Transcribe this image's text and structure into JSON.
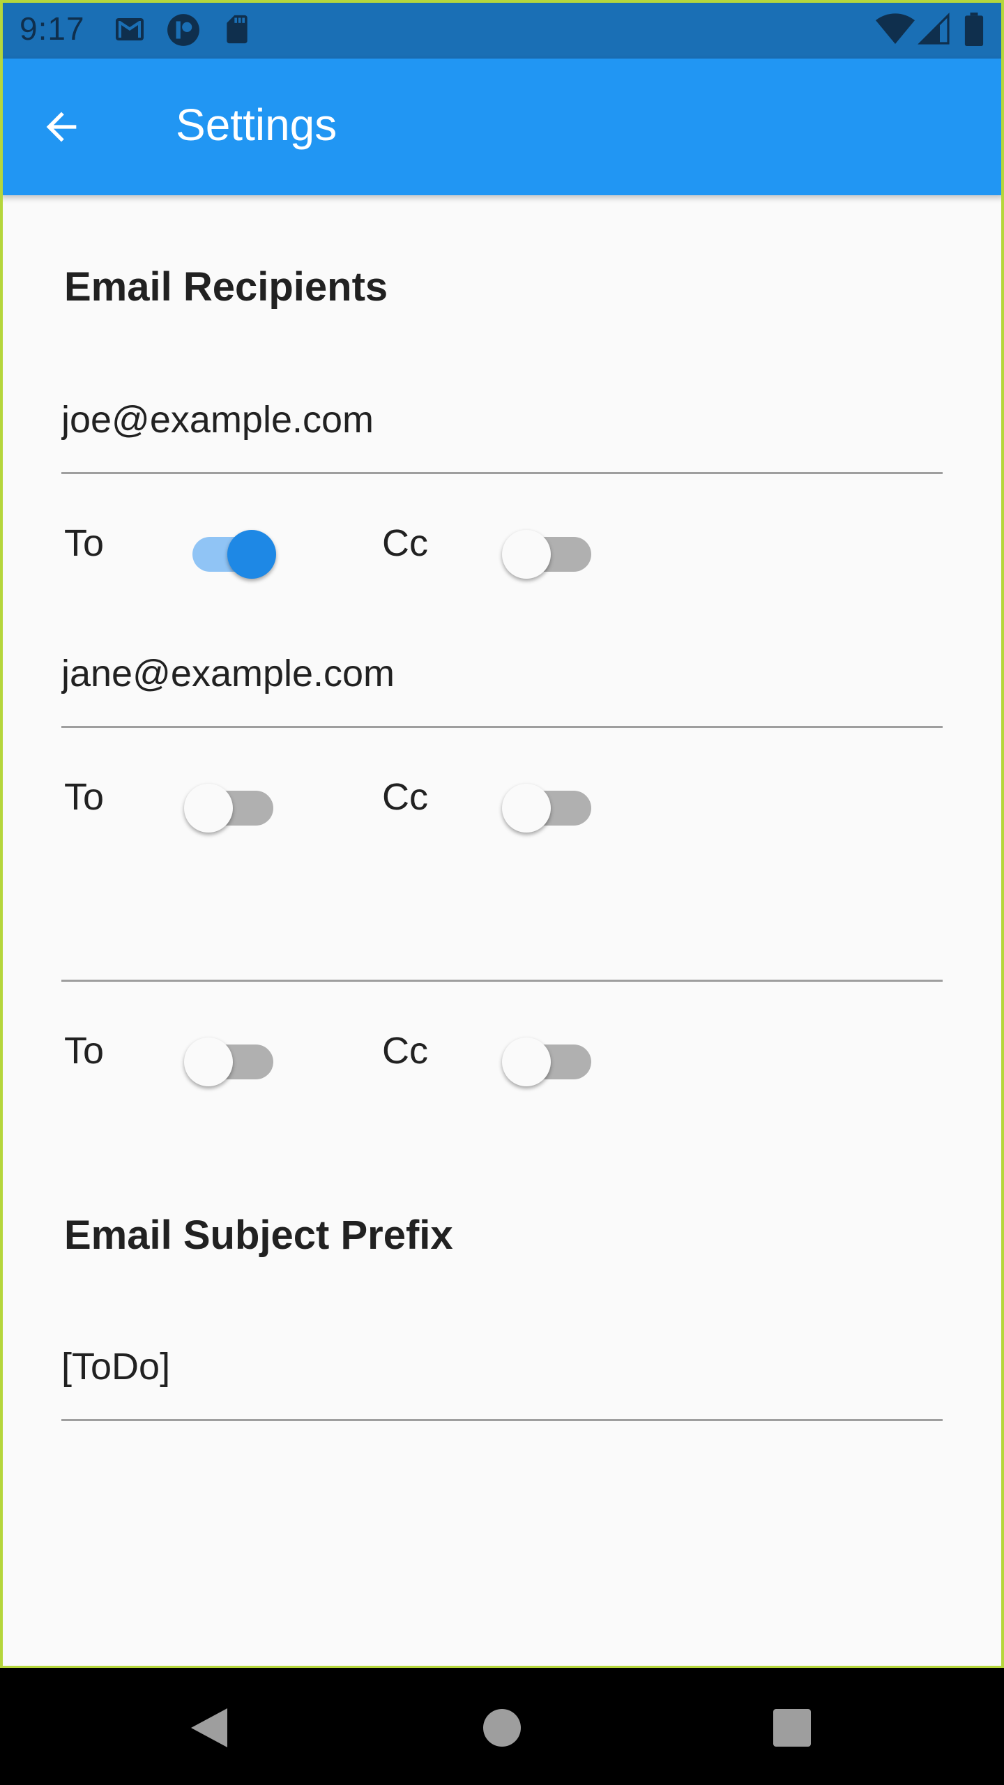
{
  "status_bar": {
    "time": "9:17",
    "left_icons": [
      "gmail-icon",
      "app-notification-icon",
      "sd-card-icon"
    ],
    "right_icons": [
      "wifi-icon",
      "cell-signal-icon",
      "battery-icon"
    ]
  },
  "app_bar": {
    "title": "Settings",
    "back_icon": "arrow-back-icon",
    "color": "#2196f3"
  },
  "recipients": {
    "title": "Email Recipients",
    "items": [
      {
        "email": "joe@example.com",
        "to_label": "To",
        "to_on": true,
        "cc_label": "Cc",
        "cc_on": false
      },
      {
        "email": "jane@example.com",
        "to_label": "To",
        "to_on": false,
        "cc_label": "Cc",
        "cc_on": false
      },
      {
        "email": "",
        "to_label": "To",
        "to_on": false,
        "cc_label": "Cc",
        "cc_on": false
      }
    ]
  },
  "subject": {
    "title": "Email Subject Prefix",
    "value": "[ToDo]"
  },
  "nav_bar": {
    "icons": [
      "back-triangle-icon",
      "home-circle-icon",
      "recents-square-icon"
    ]
  }
}
